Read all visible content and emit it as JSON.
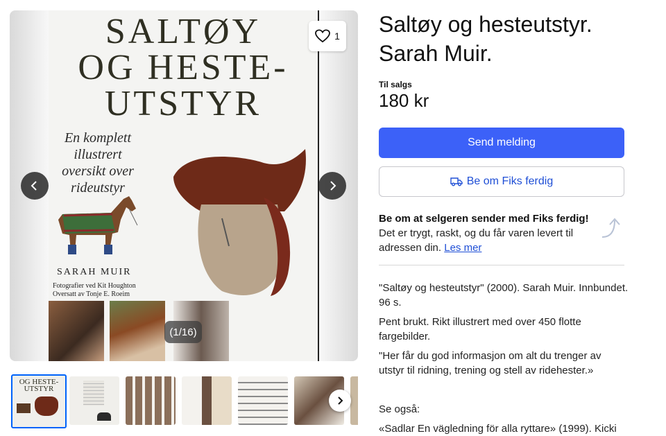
{
  "gallery": {
    "cover": {
      "title_lines": [
        "SALTØY",
        "OG HESTE-",
        "UTSTYR"
      ],
      "subtitle_lines": [
        "En komplett",
        "illustrert",
        "oversikt over",
        "rideutstyr"
      ],
      "author": "SARAH MUIR",
      "credits": "Fotografier ved Kit Houghton\nOversatt av Tonje E. Roeim"
    },
    "favorite_count": "1",
    "counter": "(1/16)"
  },
  "listing": {
    "title": "Saltøy og hesteutstyr. Sarah Muir.",
    "price_label": "Til salgs",
    "price": "180 kr",
    "send_message": "Send melding",
    "fiks_button": "Be om Fiks ferdig",
    "fiks_info_bold": "Be om at selgeren sender med Fiks ferdig!",
    "fiks_info_rest": " Det er trygt, raskt, og du får varen levert til adressen din. ",
    "fiks_read_more": "Les mer",
    "description": [
      "\"Saltøy og hesteutstyr\" (2000). Sarah Muir. Innbundet. 96 s.",
      "Pent brukt. Rikt illustrert med over 450 flotte fargebilder.",
      "\"Her får du god informasjon om alt du trenger av utstyr til ridning, trening og stell av ridehester.»",
      "Se også:",
      "«Sadlar En vägledning för alla ryttare» (1999). Kicki"
    ]
  },
  "colors": {
    "primary": "#3c61f8",
    "link": "#1f4fd6",
    "active_thumb": "#0063fb"
  }
}
